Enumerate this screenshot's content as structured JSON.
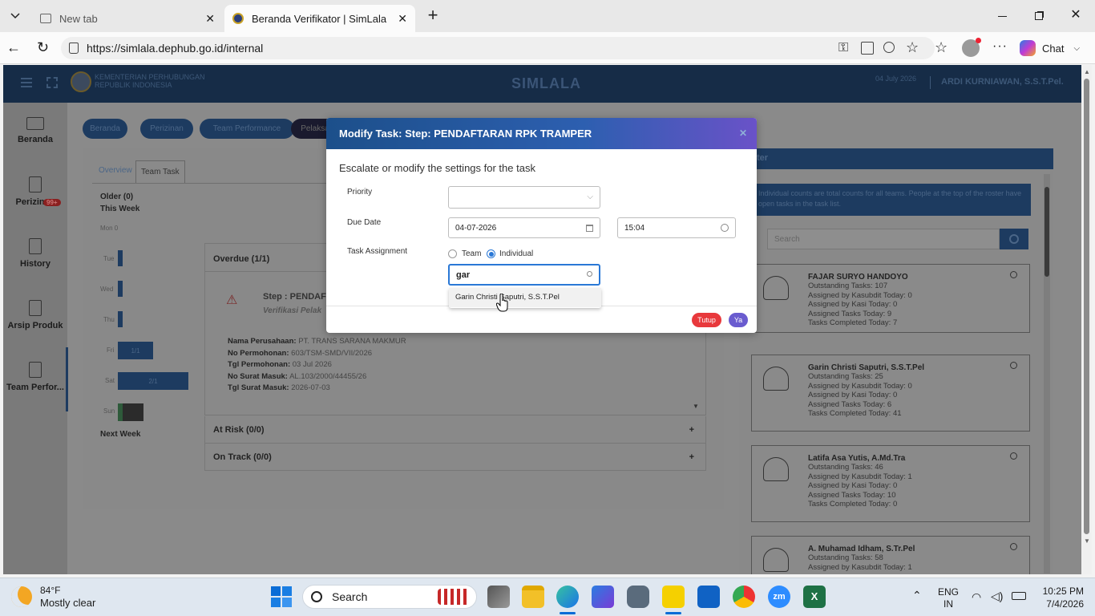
{
  "browser": {
    "tabs": [
      {
        "label": "New tab",
        "active": false
      },
      {
        "label": "Beranda Verifikator | SimLala",
        "active": true
      }
    ],
    "url": "https://simlala.dephub.go.id/internal",
    "chat_label": "Chat"
  },
  "app": {
    "org_line1": "KEMENTERIAN PERHUBUNGAN",
    "org_line2": "REPUBLIK INDONESIA",
    "title": "SIMLALA",
    "date": "04 July 2026",
    "user": "ARDI KURNIAWAN, S.S.T.Pel.",
    "sidebar": [
      "Beranda",
      "Perizinan",
      "History",
      "Arsip Produk",
      "Team Perfor..."
    ],
    "sidebar_badge": "99+",
    "nav_pills": [
      "Beranda",
      "Perizinan",
      "Team Performance",
      "Pelaksa"
    ],
    "subtabs": [
      "Overview",
      "Team Task"
    ],
    "timeline": {
      "older": "Older (0)",
      "this_week": "This Week",
      "days": [
        "Mon 0",
        "Tue",
        "Wed",
        "Thu",
        "Fri",
        "Sat",
        "Sun"
      ],
      "bar_labels": [
        "1/1",
        "2/1"
      ],
      "next_week": "Next Week"
    },
    "overdue": {
      "title": "Overdue (1/1)",
      "step": "Step : PENDAF",
      "step_sub": "Verifikasi Pelak",
      "fields": [
        {
          "label": "Nama Perusahaan:",
          "value": "PT. TRANS SARANA MAKMUR"
        },
        {
          "label": "No Permohonan:",
          "value": "603/TSM-SMD/VII/2026"
        },
        {
          "label": "Tgl Permohonan:",
          "value": "03 Jul 2026"
        },
        {
          "label": "No Surat Masuk:",
          "value": "AL.103/2000/44455/26"
        },
        {
          "label": "Tgl Surat Masuk:",
          "value": "2026-07-03"
        }
      ]
    },
    "at_risk": "At Risk (0/0)",
    "on_track": "On Track (0/0)",
    "roster": {
      "title": "ter",
      "info": "Individual counts are total counts for all teams. People at the top of the roster have open tasks in the task list.",
      "search_placeholder": "Search",
      "people": [
        {
          "name": "FAJAR SURYO HANDOYO",
          "lines": [
            "Outstanding Tasks: 107",
            "Assigned by Kasubdit Today: 0",
            "Assigned by Kasi Today: 0",
            "Assigned Tasks Today: 9",
            "Tasks Completed Today: 7"
          ]
        },
        {
          "name": "Garin Christi Saputri, S.S.T.Pel",
          "lines": [
            "Outstanding Tasks: 25",
            "Assigned by Kasubdit Today: 0",
            "Assigned by Kasi Today: 0",
            "Assigned Tasks Today: 6",
            "Tasks Completed Today: 41"
          ]
        },
        {
          "name": "Latifa Asa Yutis, A.Md.Tra",
          "lines": [
            "Outstanding Tasks: 46",
            "Assigned by Kasubdit Today: 1",
            "Assigned by Kasi Today: 0",
            "Assigned Tasks Today: 10",
            "Tasks Completed Today: 0"
          ]
        },
        {
          "name": "A. Muhamad Idham, S.Tr.Pel",
          "lines": [
            "Outstanding Tasks: 58",
            "Assigned by Kasubdit Today: 1"
          ]
        }
      ]
    }
  },
  "modal": {
    "title": "Modify Task: Step: PENDAFTARAN RPK TRAMPER",
    "subtitle": "Escalate or modify the settings for the task",
    "priority_label": "Priority",
    "due_date_label": "Due Date",
    "due_date": "04-07-2026",
    "due_time": "15:04",
    "assignment_label": "Task Assignment",
    "radio_team": "Team",
    "radio_individual": "Individual",
    "selected": "Individual",
    "search_value": "gar",
    "suggestion": "Garin Christi Saputri, S.S.T.Pel",
    "btn_close": "Tutup",
    "btn_yes": "Ya"
  },
  "taskbar": {
    "weather_temp": "84°F",
    "weather_desc": "Mostly clear",
    "search": "Search",
    "lang1": "ENG",
    "lang2": "IN",
    "time": "10:25 PM",
    "date": "7/4/2026"
  }
}
